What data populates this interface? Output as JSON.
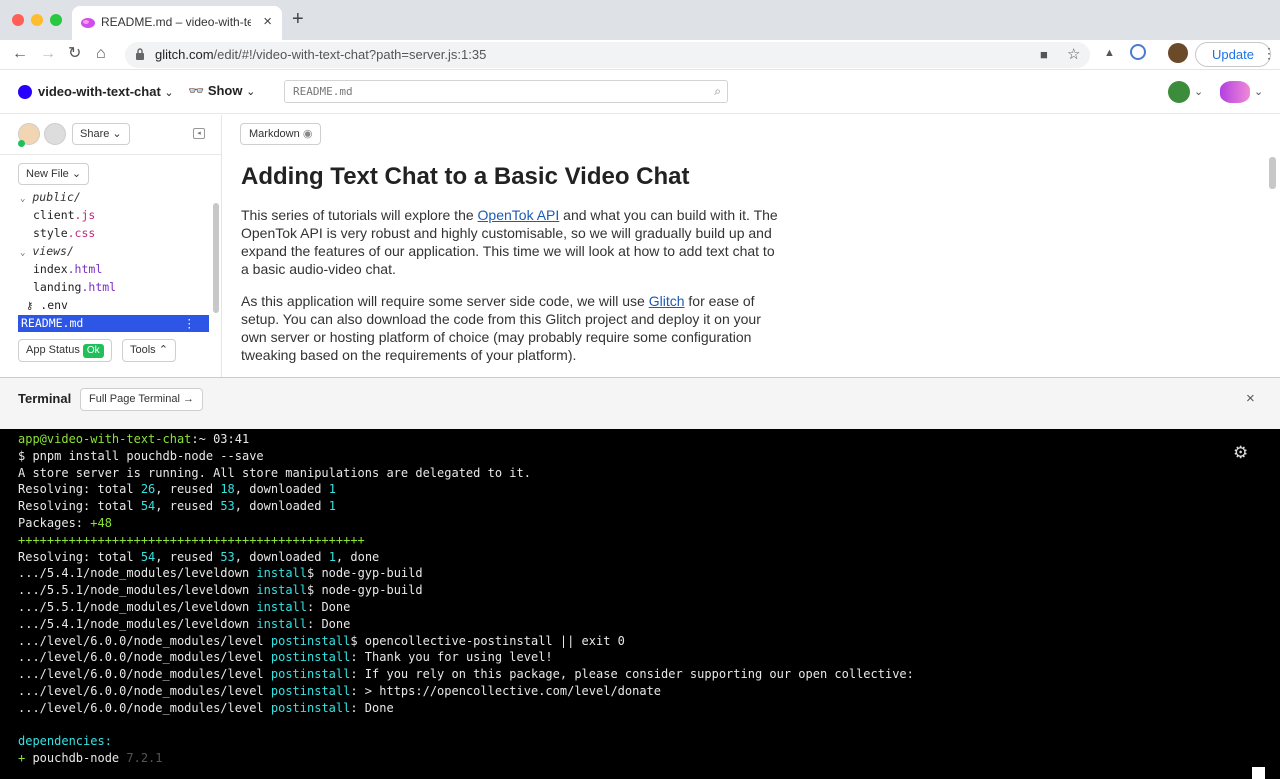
{
  "browser": {
    "tab_title": "README.md – video-with-text",
    "tab_close": "×",
    "new_tab": "+",
    "url_host": "glitch.com",
    "url_path": "/edit/#!/video-with-text-chat?path=server.js:1:35",
    "update_label": "Update",
    "traffic_colors": [
      "#ff5f57",
      "#febc2e",
      "#28c840"
    ]
  },
  "header": {
    "project_name": "video-with-text-chat",
    "project_chevron": "⌄",
    "show_label": "Show",
    "show_icon": "👓",
    "search_text": "README.md"
  },
  "sidebar": {
    "share_label": "Share",
    "new_file_label": "New File",
    "files": [
      {
        "name": "public/",
        "type": "folder"
      },
      {
        "name": "client",
        "ext": ".js",
        "type": "file"
      },
      {
        "name": "style",
        "ext": ".css",
        "type": "file"
      },
      {
        "name": "views/",
        "type": "folder"
      },
      {
        "name": "index",
        "ext": ".html",
        "type": "file"
      },
      {
        "name": "landing",
        "ext": ".html",
        "type": "file"
      },
      {
        "name": ".env",
        "type": "env"
      },
      {
        "name": "README.md",
        "type": "selected"
      }
    ],
    "app_status_label": "App Status",
    "app_status_badge": "Ok",
    "tools_label": "Tools"
  },
  "editor": {
    "mode_label": "Markdown",
    "heading": "Adding Text Chat to a Basic Video Chat",
    "p1_before": "This series of tutorials will explore the ",
    "p1_link": "OpenTok API",
    "p1_after": " and what you can build with it. The OpenTok API is very robust and highly customisable, so we will gradually build up and expand the features of our application. This time we will look at how to add text chat to a basic audio-video chat.",
    "p2_before": "As this application will require some server side code, we will use ",
    "p2_link": "Glitch",
    "p2_after": " for ease of setup. You can also download the code from this Glitch project and deploy it on your own server or hosting platform of choice (may probably require some configuration tweaking based on the requirements of your platform)."
  },
  "terminal": {
    "title": "Terminal",
    "full_page_label": "Full Page Terminal →",
    "close": "×",
    "lines": [
      [
        {
          "t": "app@video-with-text-chat",
          "c": "green"
        },
        {
          "t": ":~ 03:41"
        }
      ],
      [
        {
          "t": "$ pnpm install pouchdb-node --save"
        }
      ],
      [
        {
          "t": "A store server is running. All store manipulations are delegated to it."
        }
      ],
      [
        {
          "t": "Resolving: total "
        },
        {
          "t": "26",
          "c": "num"
        },
        {
          "t": ", reused "
        },
        {
          "t": "18",
          "c": "num"
        },
        {
          "t": ", downloaded "
        },
        {
          "t": "1",
          "c": "num"
        }
      ],
      [
        {
          "t": "Resolving: total "
        },
        {
          "t": "54",
          "c": "num"
        },
        {
          "t": ", reused "
        },
        {
          "t": "53",
          "c": "num"
        },
        {
          "t": ", downloaded "
        },
        {
          "t": "1",
          "c": "num"
        }
      ],
      [
        {
          "t": "Packages: "
        },
        {
          "t": "+48",
          "c": "green"
        }
      ],
      [
        {
          "t": "++++++++++++++++++++++++++++++++++++++++++++++++",
          "c": "green"
        }
      ],
      [
        {
          "t": "Resolving: total "
        },
        {
          "t": "54",
          "c": "num"
        },
        {
          "t": ", reused "
        },
        {
          "t": "53",
          "c": "num"
        },
        {
          "t": ", downloaded "
        },
        {
          "t": "1",
          "c": "num"
        },
        {
          "t": ", done"
        }
      ],
      [
        {
          "t": ".../5.4.1/node_modules/leveldown "
        },
        {
          "t": "install",
          "c": "cyan"
        },
        {
          "t": "$ node-gyp-build"
        }
      ],
      [
        {
          "t": ".../5.5.1/node_modules/leveldown "
        },
        {
          "t": "install",
          "c": "cyan"
        },
        {
          "t": "$ node-gyp-build"
        }
      ],
      [
        {
          "t": ".../5.5.1/node_modules/leveldown "
        },
        {
          "t": "install",
          "c": "cyan"
        },
        {
          "t": ": Done"
        }
      ],
      [
        {
          "t": ".../5.4.1/node_modules/leveldown "
        },
        {
          "t": "install",
          "c": "cyan"
        },
        {
          "t": ": Done"
        }
      ],
      [
        {
          "t": ".../level/6.0.0/node_modules/level "
        },
        {
          "t": "postinstall",
          "c": "cyan"
        },
        {
          "t": "$ opencollective-postinstall || exit 0"
        }
      ],
      [
        {
          "t": ".../level/6.0.0/node_modules/level "
        },
        {
          "t": "postinstall",
          "c": "cyan"
        },
        {
          "t": ": Thank you for using level!"
        }
      ],
      [
        {
          "t": ".../level/6.0.0/node_modules/level "
        },
        {
          "t": "postinstall",
          "c": "cyan"
        },
        {
          "t": ": If you rely on this package, please consider supporting our open collective:"
        }
      ],
      [
        {
          "t": ".../level/6.0.0/node_modules/level "
        },
        {
          "t": "postinstall",
          "c": "cyan"
        },
        {
          "t": ": > https://opencollective.com/level/donate"
        }
      ],
      [
        {
          "t": ".../level/6.0.0/node_modules/level "
        },
        {
          "t": "postinstall",
          "c": "cyan"
        },
        {
          "t": ": Done"
        }
      ],
      [
        {
          "t": ""
        }
      ],
      [
        {
          "t": "dependencies:",
          "c": "cyan"
        }
      ],
      [
        {
          "t": "+ ",
          "c": "green"
        },
        {
          "t": "pouchdb-node "
        },
        {
          "t": "7.2.1",
          "c": "dim"
        }
      ]
    ]
  }
}
